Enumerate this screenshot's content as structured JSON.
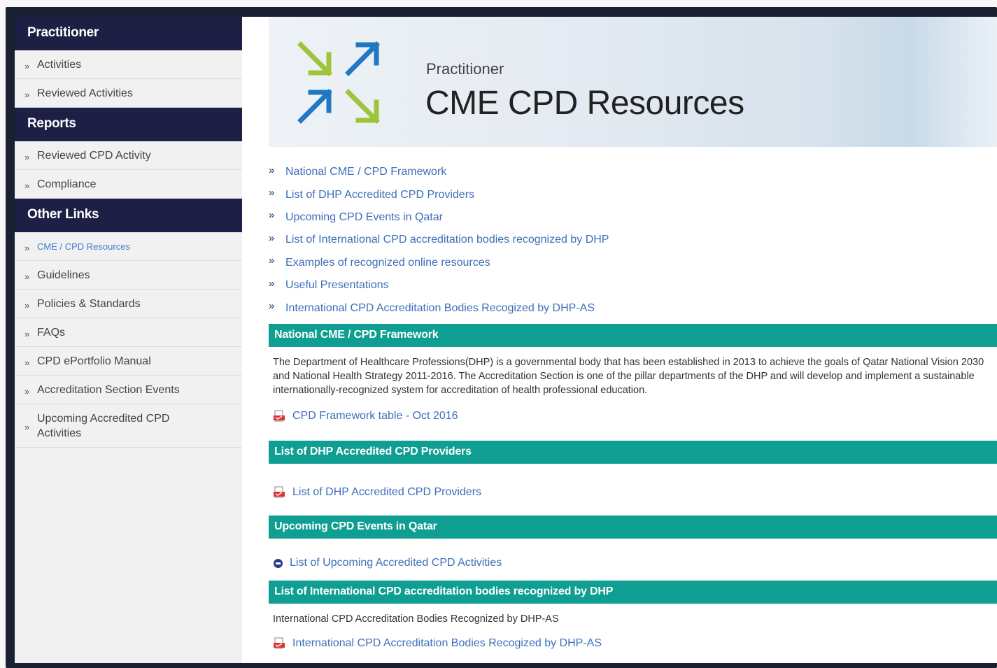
{
  "sidebar": {
    "practitioner": {
      "header": "Practitioner",
      "items": [
        "Activities",
        "Reviewed Activities"
      ]
    },
    "reports": {
      "header": "Reports",
      "items": [
        "Reviewed CPD Activity",
        "Compliance"
      ]
    },
    "other_links": {
      "header": "Other Links",
      "items": [
        "CME / CPD Resources",
        "Guidelines",
        "Policies & Standards",
        "FAQs",
        "CPD ePortfolio Manual",
        "Accreditation Section Events",
        "Upcoming Accredited CPD Activities"
      ],
      "active_index": 0
    }
  },
  "banner": {
    "subtitle": "Practitioner",
    "title": "CME CPD Resources"
  },
  "links": [
    "National CME / CPD Framework",
    "List of DHP Accredited CPD Providers",
    "Upcoming CPD Events in Qatar",
    "List of International CPD accreditation bodies recognized by DHP",
    "Examples of recognized online resources",
    "Useful Presentations",
    "International CPD Accreditation Bodies Recogized by DHP-AS"
  ],
  "sections": [
    {
      "heading": "National CME / CPD Framework",
      "text": "The Department of Healthcare Professions(DHP) is a governmental body that has been established in 2013 to achieve the goals of Qatar National Vision 2030 and National Health Strategy 2011-2016. The Accreditation Section is one of the pillar departments of the DHP and will develop and implement a sustainable internationally-recognized system for accreditation of health professional education.",
      "file": "CPD Framework table - Oct 2016"
    },
    {
      "heading": "List of DHP Accredited CPD Providers",
      "file": "List of DHP Accredited CPD Providers"
    },
    {
      "heading": "Upcoming CPD Events in Qatar",
      "file": "List of Upcoming Accredited CPD Activities"
    },
    {
      "heading": "List of International CPD accreditation bodies recognized by DHP",
      "text": "International CPD Accreditation Bodies Recognized by DHP-AS",
      "file": "International CPD Accreditation Bodies Recogized by DHP-AS"
    }
  ],
  "colors": {
    "sidebar_header": "#1d1f45",
    "section_header": "#0f9e92",
    "link": "#3d6fb8",
    "logo_green": "#9dc43a",
    "logo_blue": "#1f78c1"
  },
  "icons": {
    "chevron": "»",
    "file": "pdf-file-icon",
    "bullet": "minus-circle-icon",
    "logo": "cpd-arrows-logo"
  }
}
